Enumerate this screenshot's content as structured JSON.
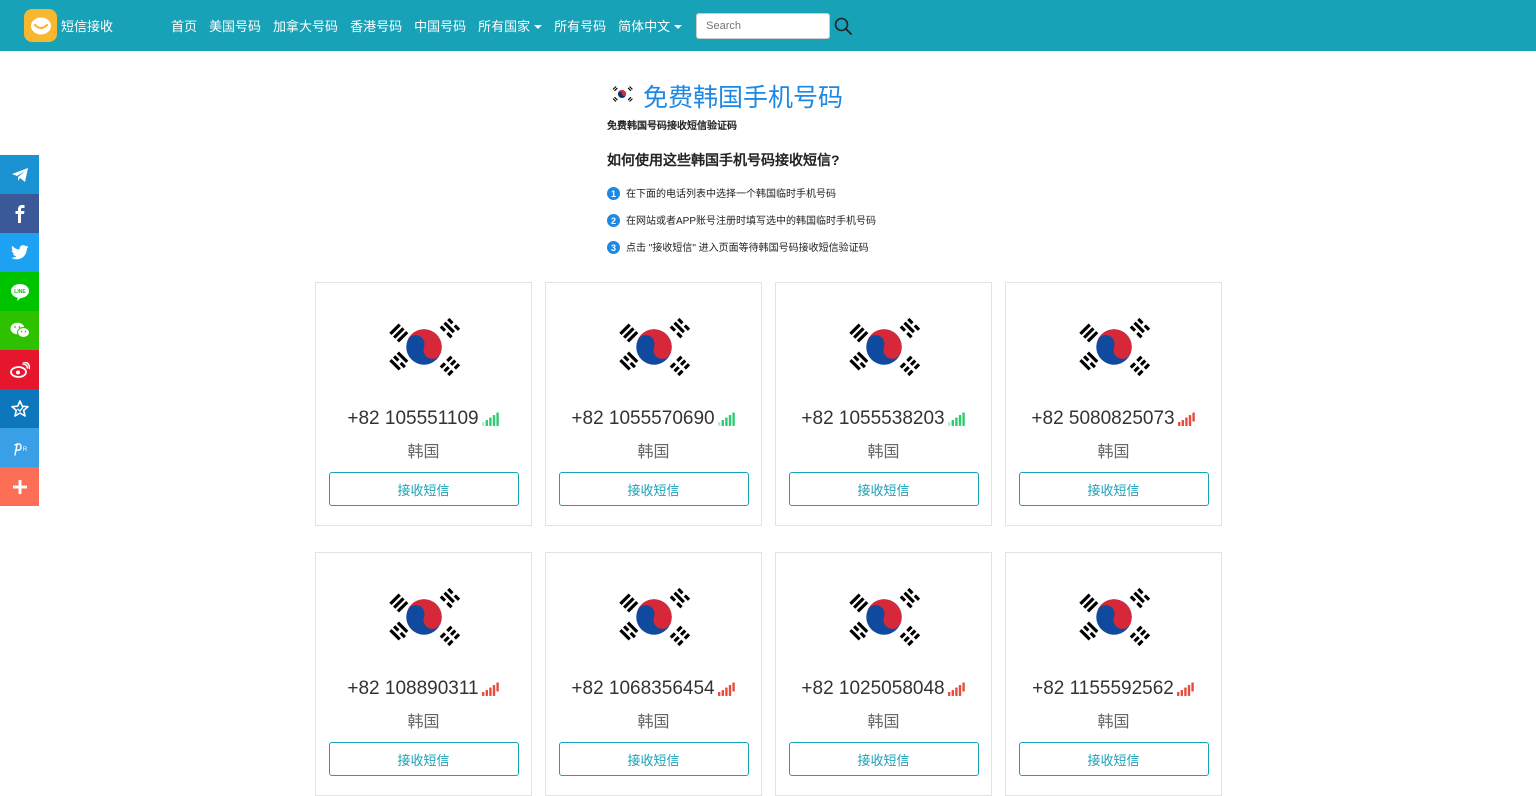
{
  "brand": {
    "name": "短信接收"
  },
  "nav": {
    "links": [
      "首页",
      "美国号码",
      "加拿大号码",
      "香港号码",
      "中国号码",
      "所有国家",
      "所有号码",
      "简体中文"
    ],
    "search_placeholder": "Search"
  },
  "share": [
    "telegram",
    "facebook",
    "twitter",
    "line",
    "wechat",
    "weibo",
    "favorites",
    "pinterest",
    "more"
  ],
  "header": {
    "title": "免费韩国手机号码",
    "subtitle": "免费韩国号码接收短信验证码",
    "howto_title": "如何使用这些韩国手机号码接收短信?",
    "steps": [
      {
        "num": "1",
        "text": "在下面的电话列表中选择一个韩国临时手机号码"
      },
      {
        "num": "2",
        "text": "在网站或者APP账号注册时填写选中的韩国临时手机号码"
      },
      {
        "num": "3",
        "text": "点击 \"接收短信\" 进入页面等待韩国号码接收短信验证码"
      }
    ]
  },
  "cards": [
    {
      "number": "+82 105551109",
      "country": "韩国",
      "button": "接收短信",
      "signal": "green"
    },
    {
      "number": "+82 1055570690",
      "country": "韩国",
      "button": "接收短信",
      "signal": "green"
    },
    {
      "number": "+82 1055538203",
      "country": "韩国",
      "button": "接收短信",
      "signal": "green"
    },
    {
      "number": "+82 5080825073",
      "country": "韩国",
      "button": "接收短信",
      "signal": "red"
    },
    {
      "number": "+82 108890311",
      "country": "韩国",
      "button": "接收短信",
      "signal": "red"
    },
    {
      "number": "+82 1068356454",
      "country": "韩国",
      "button": "接收短信",
      "signal": "red"
    },
    {
      "number": "+82 1025058048",
      "country": "韩国",
      "button": "接收短信",
      "signal": "red"
    },
    {
      "number": "+82 1155592562",
      "country": "韩国",
      "button": "接收短信",
      "signal": "red"
    }
  ],
  "colors": {
    "navbar": "#17a2b8",
    "title": "#1e88e5",
    "signal_green": "#2ecc71",
    "signal_red": "#e74c3c"
  }
}
